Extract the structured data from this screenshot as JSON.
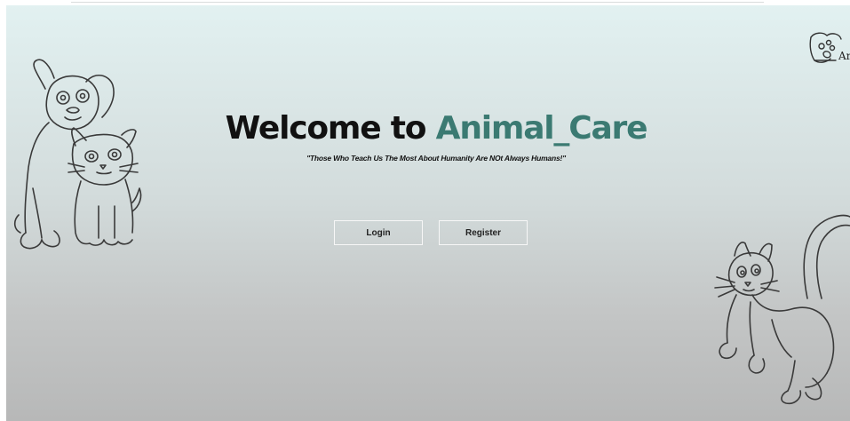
{
  "hero": {
    "title_prefix": "Welcome to ",
    "title_brand": "Animal_Care",
    "tagline": "\"Those Who Teach Us The Most About Humanity Are NOt Always Humans!\""
  },
  "buttons": {
    "login_label": "Login",
    "register_label": "Register"
  },
  "logo": {
    "text_fragment": "Ar"
  },
  "icons": {
    "left_illustration": "dog-and-kitten-sketch",
    "right_illustration": "cat-sketch",
    "corner_logo": "hands-holding-paw-logo"
  },
  "colors": {
    "brand": "#3b7a72",
    "title_text": "#111111",
    "button_border": "#f7f7f7",
    "bg_top": "#e2f1f1",
    "bg_bottom": "#b7b8b8"
  }
}
